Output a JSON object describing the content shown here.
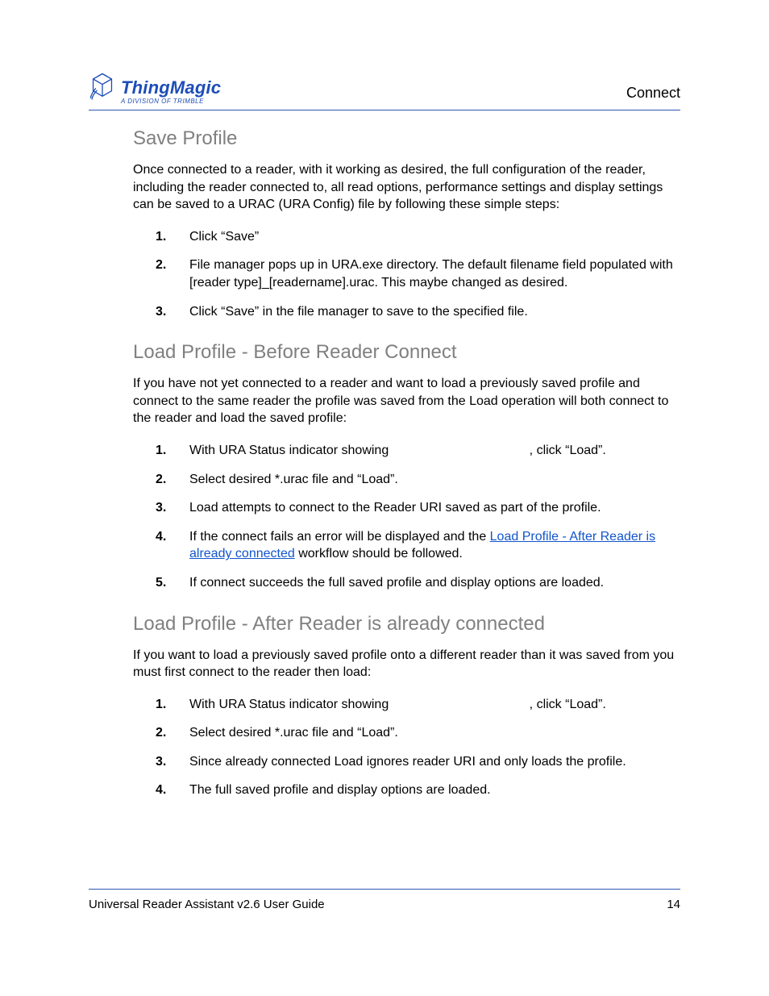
{
  "brand": {
    "name": "ThingMagic",
    "tagline": "A DIVISION OF TRIMBLE"
  },
  "header": {
    "section": "Connect"
  },
  "sections": {
    "save": {
      "heading": "Save Profile",
      "intro": "Once connected to a reader, with it working as desired, the full configuration of the reader, including the reader connected to, all read options, performance settings and display settings can be saved to a URAC (URA Config) file by following these simple steps:",
      "steps": [
        "Click “Save”",
        "File manager pops up in URA.exe directory. The default filename field populated with [reader type]_[readername].urac. This maybe changed as desired.",
        "Click “Save” in the file manager to save to the specified file."
      ]
    },
    "load_before": {
      "heading": "Load Profile - Before Reader Connect",
      "intro": "If you have not yet connected to a reader and want to load a previously saved profile and connect to the same reader the profile was saved from the Load operation will both connect to the reader and load the saved profile:",
      "step1_a": "With URA Status indicator showing ",
      "step1_b": ", click “Load”.",
      "step2": "Select desired *.urac file and “Load”.",
      "step3": "Load attempts to connect to the Reader URI saved as part of the profile.",
      "step4_a": "If the connect fails an error will be displayed and the ",
      "step4_link": "Load Profile - After Reader is already connected",
      "step4_b": " workflow should be followed.",
      "step5": "If connect succeeds the full saved profile and display options are loaded."
    },
    "load_after": {
      "heading": "Load Profile - After Reader is already connected",
      "intro": "If you want to load a previously saved profile onto a different reader than it was saved from you must first connect to the reader then load:",
      "step1_a": "With URA Status indicator showing ",
      "step1_b": ", click “Load”.",
      "step2": "Select desired *.urac file and “Load”.",
      "step3": "Since already connected Load ignores reader URI and only loads the profile.",
      "step4": "The full saved profile and display options are loaded."
    }
  },
  "numbers": {
    "n1": "1.",
    "n2": "2.",
    "n3": "3.",
    "n4": "4.",
    "n5": "5."
  },
  "footer": {
    "guide": "Universal Reader Assistant v2.6 User Guide",
    "page": "14"
  }
}
